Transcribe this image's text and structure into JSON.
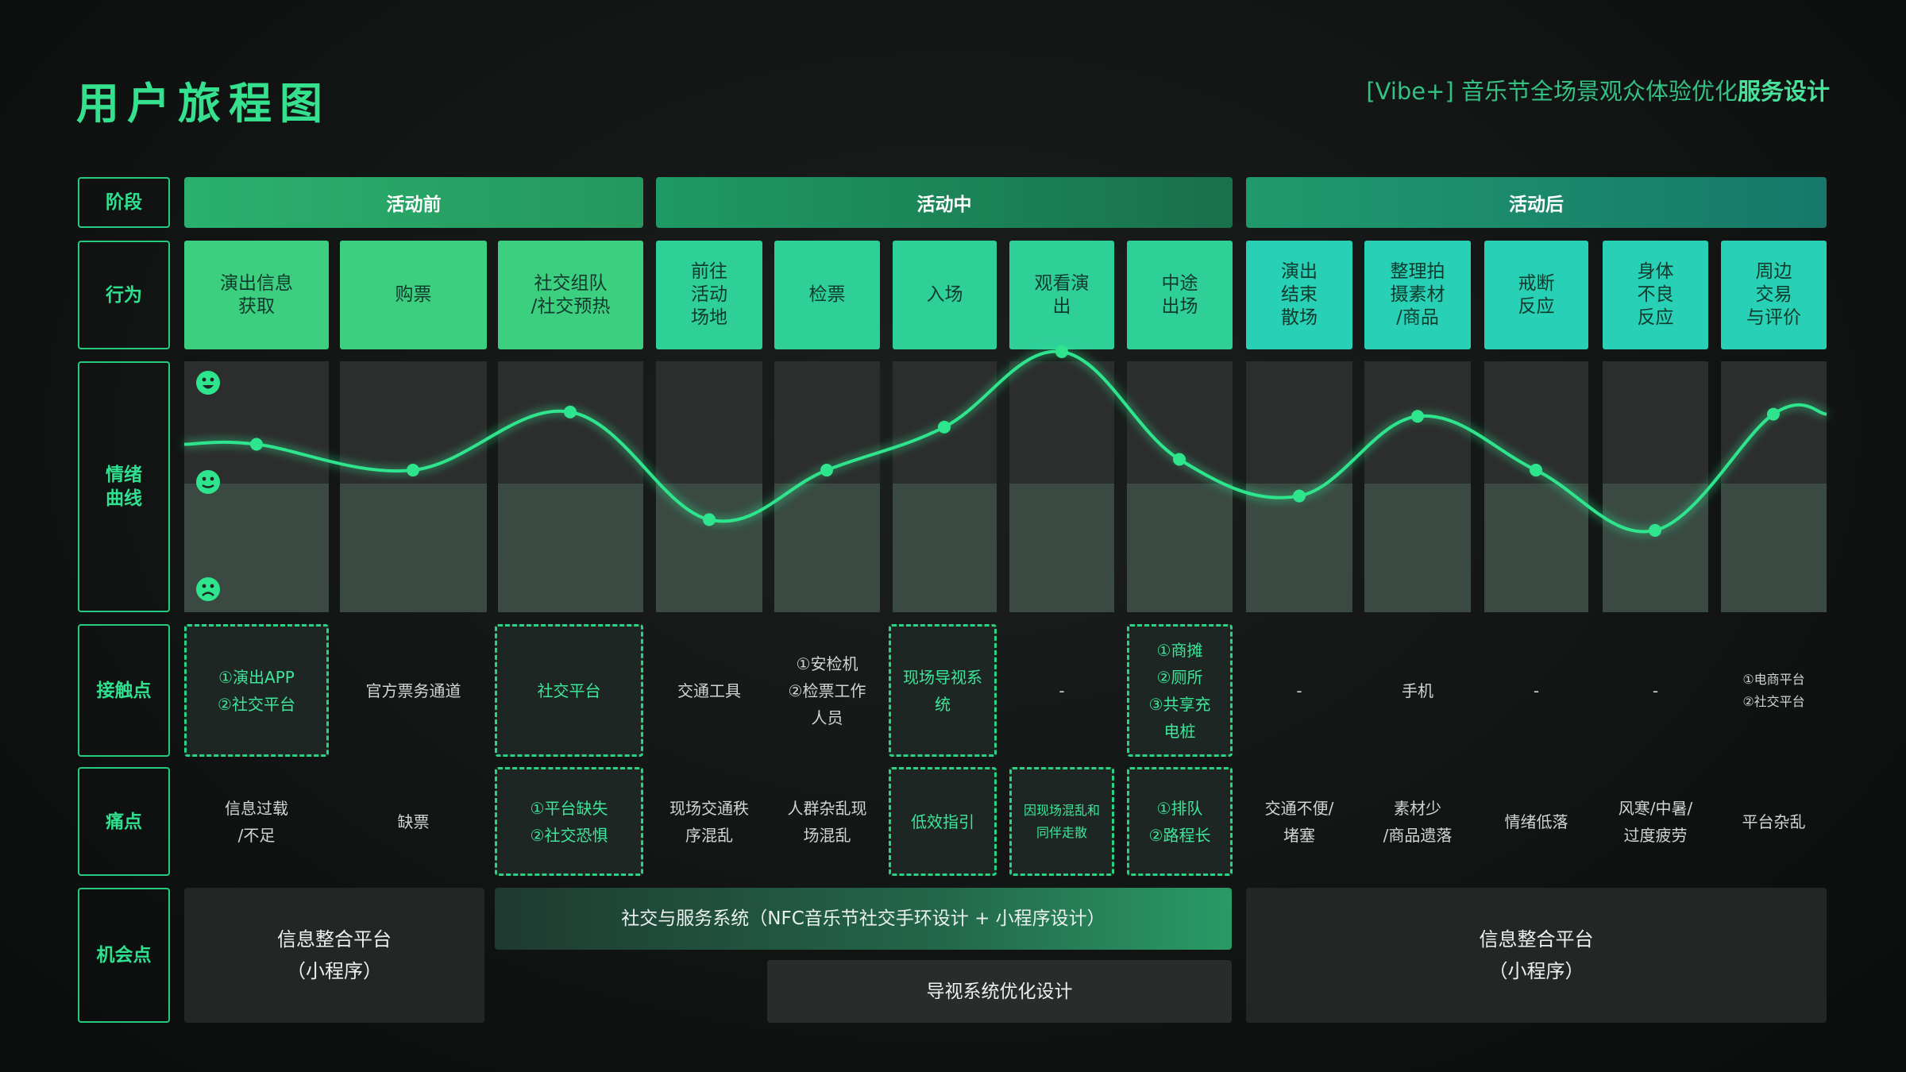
{
  "header": {
    "title": "用户旅程图",
    "subtitle_main": "[Vibe+] 音乐节全场景观众体验优化",
    "subtitle_bold": "服务设计"
  },
  "rows": {
    "stage": "阶段",
    "action": "行为",
    "emotion": "情绪\n曲线",
    "touchpoint": "接触点",
    "painpoint": "痛点",
    "opportunity": "机会点"
  },
  "stages": [
    {
      "label": "活动前",
      "color": "#2aa86a"
    },
    {
      "label": "活动中",
      "color": "#1f8a62"
    },
    {
      "label": "活动后",
      "color": "#1c8a72"
    }
  ],
  "actions": [
    "演出信息\n获取",
    "购票",
    "社交组队\n/社交预热",
    "前往\n活动\n场地",
    "检票",
    "入场",
    "观看演\n出",
    "中途\n出场",
    "演出\n结束\n散场",
    "整理拍\n摄素材\n/商品",
    "戒断\n反应",
    "身体\n不良\n反应",
    "周边\n交易\n与评价"
  ],
  "emotion_icons": {
    "happy": "happy-face-icon",
    "neutral": "neutral-face-icon",
    "sad": "sad-face-icon"
  },
  "emotion_levels": [
    0.57,
    0.45,
    0.72,
    0.22,
    0.45,
    0.65,
    1.0,
    0.5,
    0.33,
    0.7,
    0.45,
    0.17,
    0.71
  ],
  "touchpoints": [
    {
      "text": "①演出APP\n②社交平台",
      "highlight": true
    },
    {
      "text": "官方票务通道",
      "highlight": false
    },
    {
      "text": "社交平台",
      "highlight": true
    },
    {
      "text": "交通工具",
      "highlight": false
    },
    {
      "text": "①安检机\n②检票工作\n人员",
      "highlight": false
    },
    {
      "text": "现场导视系\n统",
      "highlight": true
    },
    {
      "text": "-",
      "highlight": false
    },
    {
      "text": "①商摊\n②厕所\n③共享充\n电桩",
      "highlight": true
    },
    {
      "text": "-",
      "highlight": false
    },
    {
      "text": "手机",
      "highlight": false
    },
    {
      "text": "-",
      "highlight": false
    },
    {
      "text": "-",
      "highlight": false
    },
    {
      "text": "①电商平台\n②社交平台",
      "highlight": false
    }
  ],
  "painpoints": [
    {
      "text": "信息过载\n/不足",
      "highlight": false
    },
    {
      "text": "缺票",
      "highlight": false
    },
    {
      "text": "①平台缺失\n②社交恐惧",
      "highlight": true
    },
    {
      "text": "现场交通秩\n序混乱",
      "highlight": false
    },
    {
      "text": "人群杂乱现\n场混乱",
      "highlight": false
    },
    {
      "text": "低效指引",
      "highlight": true
    },
    {
      "text": "因现场混乱和\n同伴走散",
      "highlight": true
    },
    {
      "text": "①排队\n②路程长",
      "highlight": true
    },
    {
      "text": "交通不便/\n堵塞",
      "highlight": false
    },
    {
      "text": "素材少\n/商品遗落",
      "highlight": false
    },
    {
      "text": "情绪低落",
      "highlight": false
    },
    {
      "text": "风寒/中暑/\n过度疲劳",
      "highlight": false
    },
    {
      "text": "平台杂乱",
      "highlight": false
    }
  ],
  "opportunities": {
    "left": "信息整合平台\n（小程序）",
    "social": "社交与服务系统（NFC音乐节社交手环设计 + 小程序设计）",
    "guide": "导视系统优化设计",
    "right": "信息整合平台\n（小程序）"
  },
  "colors": {
    "accent": "#2fe08f",
    "curve": "#2ee58d",
    "action_before": "#3ccf7f",
    "action_during": "#2fcf98",
    "action_after": "#28d0b6"
  }
}
